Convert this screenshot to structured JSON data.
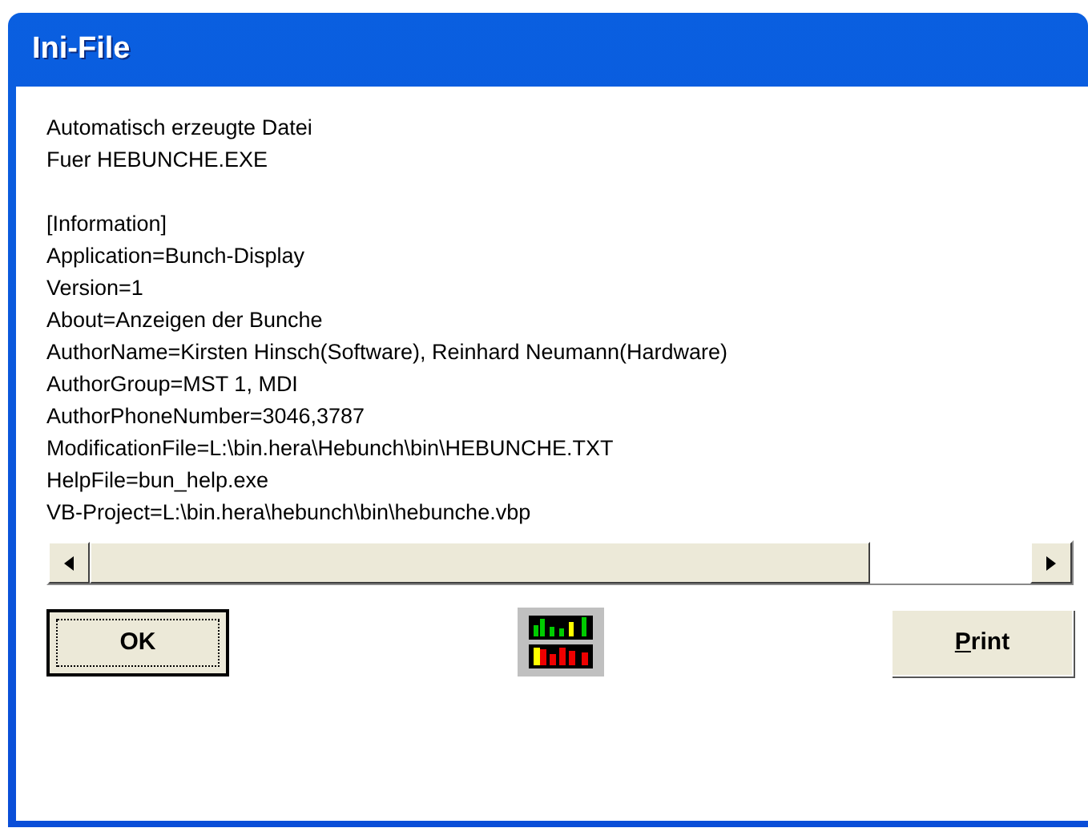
{
  "window": {
    "title": "Ini-File"
  },
  "header_lines": [
    "Automatisch erzeugte Datei",
    "Fuer HEBUNCHE.EXE"
  ],
  "content_lines": [
    "[Information]",
    "Application=Bunch-Display",
    "Version=1",
    "About=Anzeigen der Bunche",
    "AuthorName=Kirsten Hinsch(Software), Reinhard Neumann(Hardware)",
    "AuthorGroup=MST 1, MDI",
    "AuthorPhoneNumber=3046,3787",
    "ModificationFile=L:\\bin.hera\\Hebunch\\bin\\HEBUNCHE.TXT",
    "HelpFile=bun_help.exe",
    "VB-Project=L:\\bin.hera\\hebunch\\bin\\hebunche.vbp"
  ],
  "buttons": [
    {
      "label": "OK",
      "focused": true
    },
    {
      "label": "**P**rint",
      "focused": false
    }
  ]
}
